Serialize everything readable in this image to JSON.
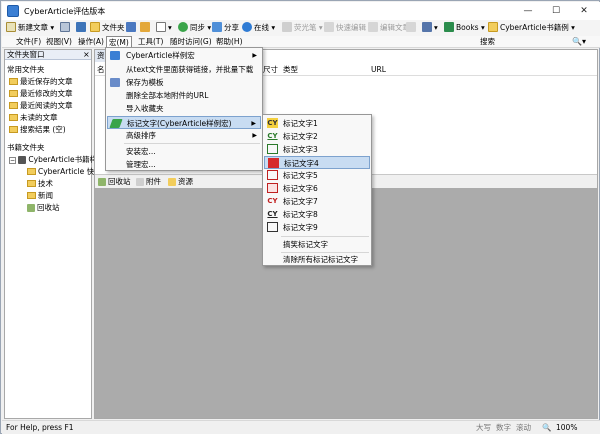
{
  "window": {
    "title": "CyberArticle评估版本"
  },
  "window_controls": {
    "minimize": "—",
    "maximize": "☐",
    "close": "✕"
  },
  "toolbar": {
    "new_article": "新建文章",
    "folder": "文件夹",
    "sync": "同步",
    "share": "分享",
    "online": "在线",
    "favorites": "荧光笔",
    "quick_edit": "快速编辑",
    "edit_article": "编辑文章",
    "books": "Books",
    "book_name": "CyberArticle书籍例"
  },
  "menubar": {
    "items": [
      "文件(F)",
      "视图(V)",
      "操作(A)",
      "宏(M)",
      "工具(T)",
      "随时访问(G)",
      "帮助(H)"
    ],
    "search_label": "搜索"
  },
  "left_pane": {
    "header": "文件夹窗口",
    "common_title": "常用文件夹",
    "common_items": [
      "最近保存的文章",
      "最近修改的文章",
      "最近阅读的文章",
      "未读的文章",
      "搜索结果 (空)"
    ],
    "book_title": "书籍文件夹",
    "tree": [
      "CyberArticle书籍样",
      "CyberArticle 快",
      "技术",
      "新闻",
      "回收站"
    ]
  },
  "list": {
    "tab_label": "资",
    "columns": [
      "名",
      "尺寸",
      "类型",
      "URL"
    ]
  },
  "bottom_tabs": [
    "回收站",
    "附件",
    "资源"
  ],
  "macro_menu": {
    "items": [
      "CyberArticle样例宏",
      "从text文件里面获得链接，并批量下载",
      "保存为模板",
      "删除全部本地附件的URL",
      "导入收藏夹",
      "标记文字(CyberArticle样例宏)",
      "高级排序",
      "安装宏...",
      "管理宏..."
    ]
  },
  "mark_submenu": {
    "items": [
      "标记文字1",
      "标记文字2",
      "标记文字3",
      "标记文字4",
      "标记文字5",
      "标记文字6",
      "标记文字7",
      "标记文字8",
      "标记文字9",
      "搞笑标记文字",
      "清除所有标记标记文字"
    ],
    "icon_text": [
      "CY",
      "CY",
      "",
      "",
      "",
      "",
      "CY",
      "CY",
      ""
    ]
  },
  "status": {
    "help": "For Help, press F1",
    "caps": "大写",
    "num": "数字",
    "scroll": "滚动",
    "zoom": "100%"
  },
  "colors": {
    "menu_highlight": "#c8dcf2",
    "gray_area": "#ababab",
    "accent": "#3b7fd4"
  }
}
